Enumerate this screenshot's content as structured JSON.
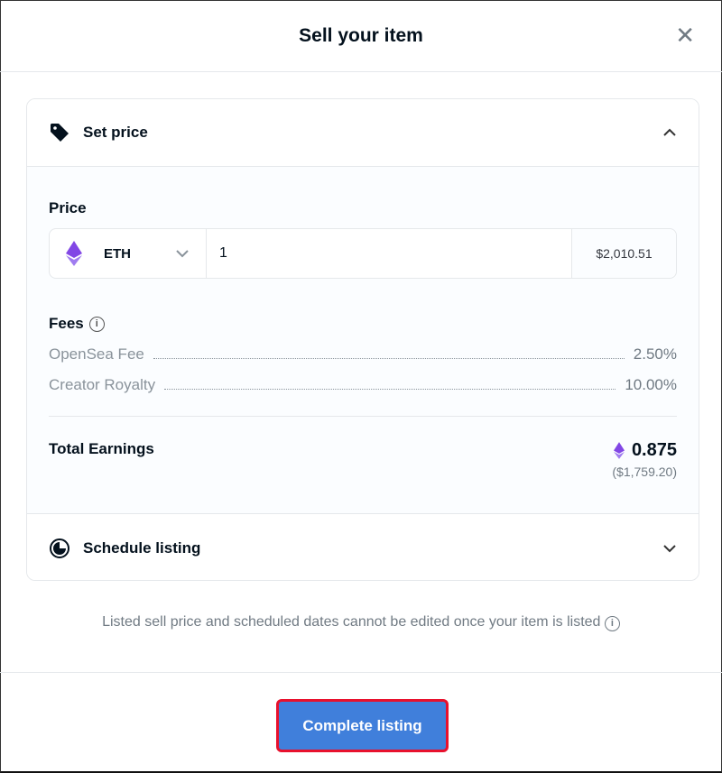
{
  "modal": {
    "title": "Sell your item",
    "close_icon": "close-icon"
  },
  "set_price": {
    "title": "Set price",
    "icon": "tag-icon",
    "expanded": true,
    "price_label": "Price",
    "currency": "ETH",
    "amount": "1",
    "usd_value": "$2,010.51",
    "fees_label": "Fees",
    "fees": [
      {
        "label": "OpenSea Fee",
        "value": "2.50%"
      },
      {
        "label": "Creator Royalty",
        "value": "10.00%"
      }
    ],
    "total_label": "Total Earnings",
    "total_eth": "0.875",
    "total_usd": "($1,759.20)"
  },
  "schedule": {
    "title": "Schedule listing",
    "icon": "clock-icon",
    "expanded": false
  },
  "note": "Listed sell price and scheduled dates cannot be edited once your item is listed",
  "button": "Complete listing",
  "colors": {
    "primary": "#407fdb",
    "highlight": "#e8112d",
    "eth": "#8247e5"
  }
}
